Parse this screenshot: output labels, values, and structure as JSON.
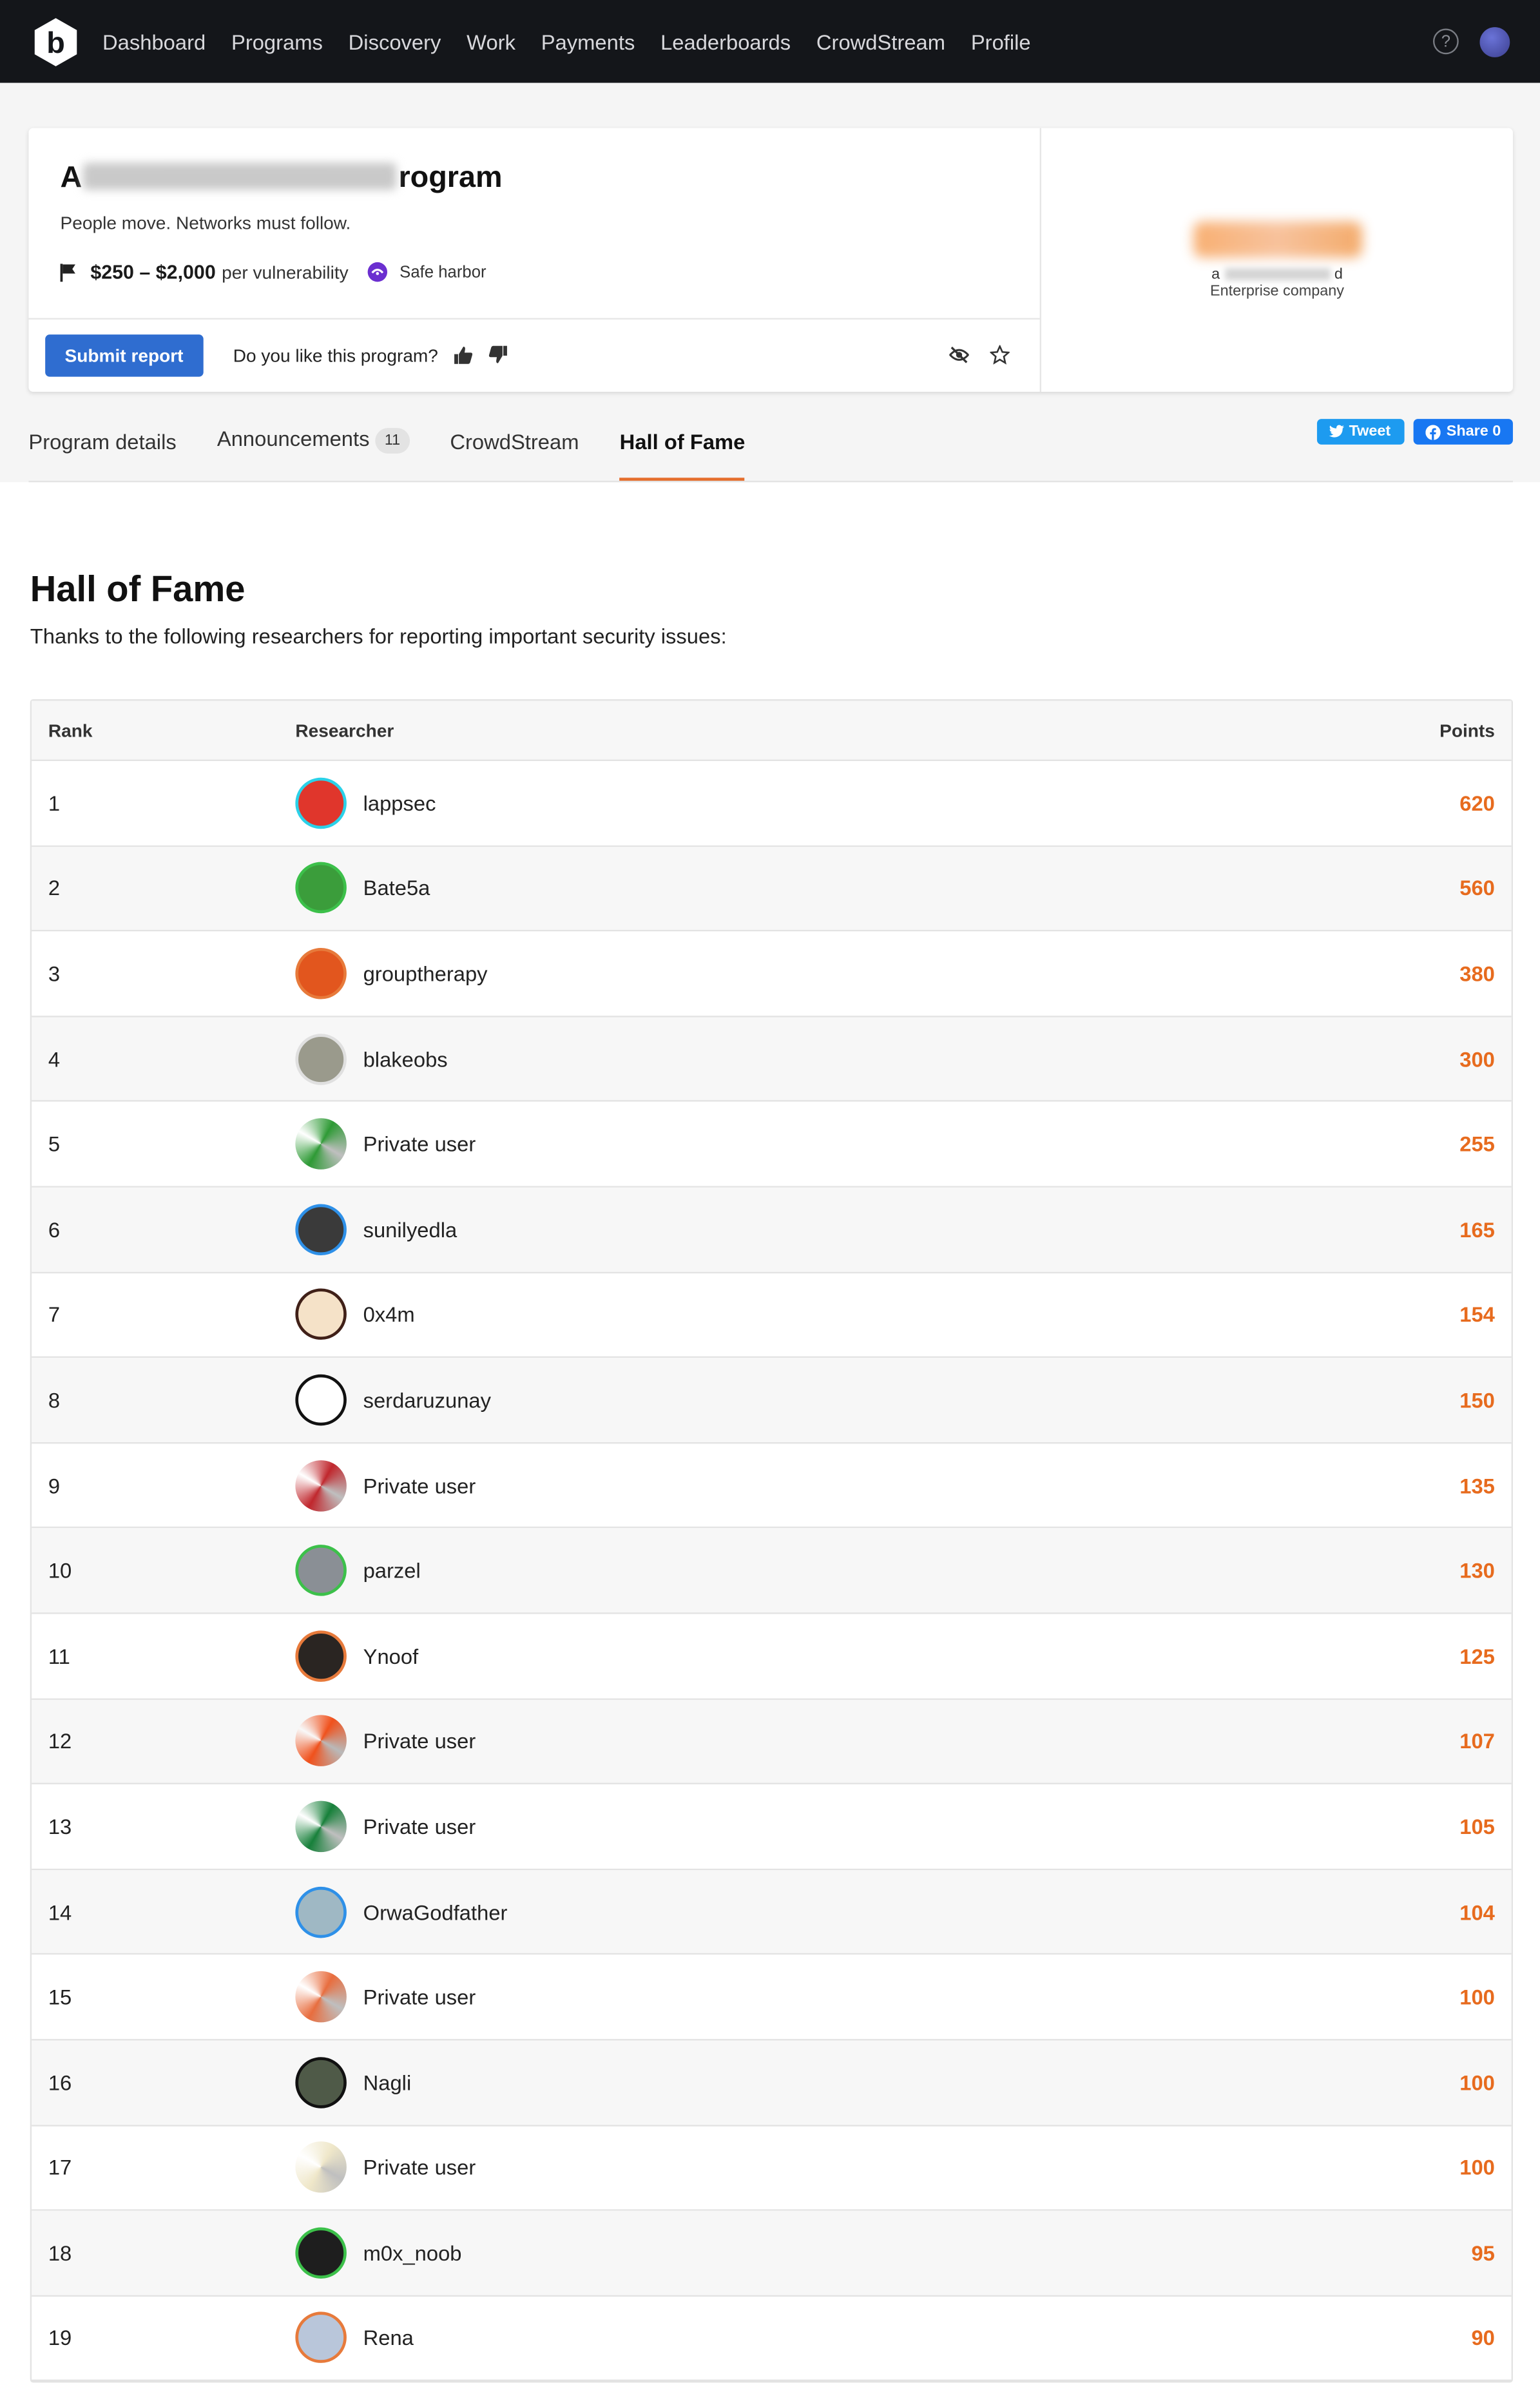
{
  "nav": {
    "items": [
      "Dashboard",
      "Programs",
      "Discovery",
      "Work",
      "Payments",
      "Leaderboards",
      "CrowdStream",
      "Profile"
    ]
  },
  "program": {
    "title_prefix": "A",
    "title_suffix": "rogram",
    "tagline": "People move. Networks must follow.",
    "reward": "$250 – $2,000",
    "reward_unit": "per vulnerability",
    "safe_harbor": "Safe harbor",
    "submit_label": "Submit report",
    "like_question": "Do you like this program?",
    "company_prefix": "a",
    "company_suffix": "d",
    "company_type": "Enterprise company"
  },
  "tabs": {
    "program_details": "Program details",
    "announcements": "Announcements",
    "announcements_count": "11",
    "crowdstream": "CrowdStream",
    "hall_of_fame": "Hall of Fame"
  },
  "social": {
    "tweet": "Tweet",
    "share": "Share 0"
  },
  "hof": {
    "title": "Hall of Fame",
    "subtitle": "Thanks to the following researchers for reporting important security issues:",
    "columns": {
      "rank": "Rank",
      "researcher": "Researcher",
      "points": "Points"
    },
    "rows": [
      {
        "rank": "1",
        "name": "lappsec",
        "points": "620",
        "avatar": "#e0362c"
      },
      {
        "rank": "2",
        "name": "Bate5a",
        "points": "560",
        "avatar": "#3b9d3b"
      },
      {
        "rank": "3",
        "name": "grouptherapy",
        "points": "380",
        "avatar": "#e2561e"
      },
      {
        "rank": "4",
        "name": "blakeobs",
        "points": "300",
        "avatar": "#9a9a8c"
      },
      {
        "rank": "5",
        "name": "Private user",
        "points": "255",
        "avatar": "#2e9a35"
      },
      {
        "rank": "6",
        "name": "sunilyedla",
        "points": "165",
        "avatar": "#3a3a3a"
      },
      {
        "rank": "7",
        "name": "0x4m",
        "points": "154",
        "avatar": "#f5e2c8"
      },
      {
        "rank": "8",
        "name": "serdaruzunay",
        "points": "150",
        "avatar": "#ffffff"
      },
      {
        "rank": "9",
        "name": "Private user",
        "points": "135",
        "avatar": "#c0272d"
      },
      {
        "rank": "10",
        "name": "parzel",
        "points": "130",
        "avatar": "#8a8f95"
      },
      {
        "rank": "11",
        "name": "Ynoof",
        "points": "125",
        "avatar": "#2a2522"
      },
      {
        "rank": "12",
        "name": "Private user",
        "points": "107",
        "avatar": "#f0511c"
      },
      {
        "rank": "13",
        "name": "Private user",
        "points": "105",
        "avatar": "#17803a"
      },
      {
        "rank": "14",
        "name": "OrwaGodfather",
        "points": "104",
        "avatar": "#9fb8c4"
      },
      {
        "rank": "15",
        "name": "Private user",
        "points": "100",
        "avatar": "#e86d3e"
      },
      {
        "rank": "16",
        "name": "Nagli",
        "points": "100",
        "avatar": "#4f5a48"
      },
      {
        "rank": "17",
        "name": "Private user",
        "points": "100",
        "avatar": "#efe7c9"
      },
      {
        "rank": "18",
        "name": "m0x_noob",
        "points": "95",
        "avatar": "#1e1e1e"
      },
      {
        "rank": "19",
        "name": "Rena",
        "points": "90",
        "avatar": "#b9c6da"
      }
    ]
  },
  "colors": {
    "nav_bg": "#14161a",
    "primary": "#2f6dd0",
    "accent": "#e56e2d",
    "points": "#e76b1e"
  }
}
